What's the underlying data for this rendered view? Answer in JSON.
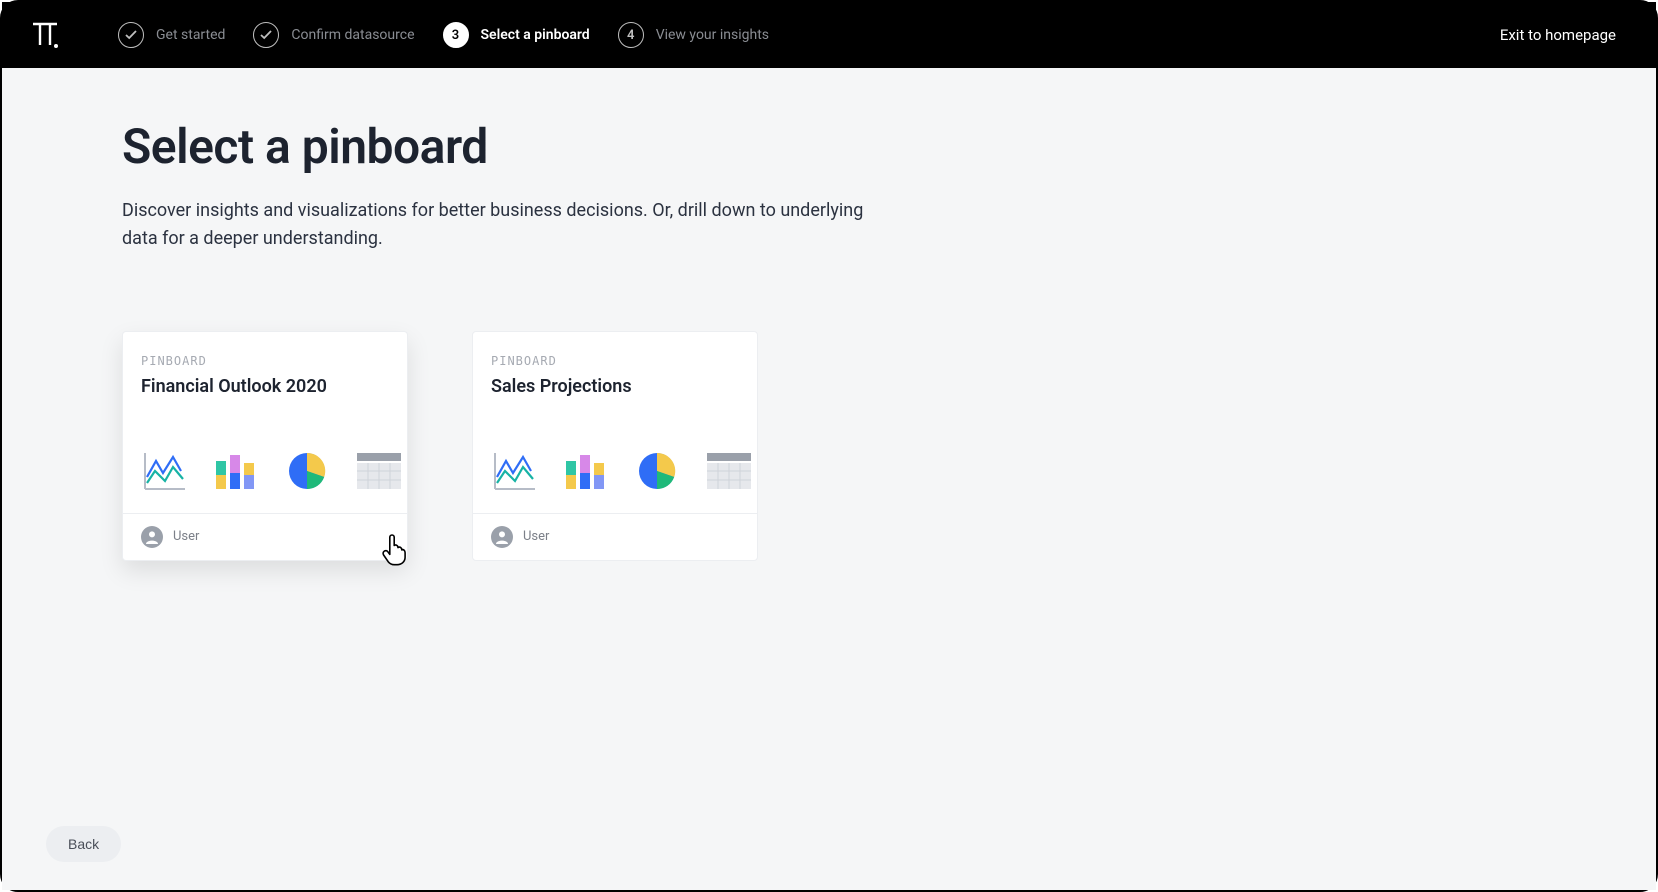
{
  "header": {
    "steps": [
      {
        "label": "Get started",
        "state": "done",
        "content": "check"
      },
      {
        "label": "Confirm datasource",
        "state": "done",
        "content": "check"
      },
      {
        "label": "Select a pinboard",
        "state": "active",
        "content": "3"
      },
      {
        "label": "View your insights",
        "state": "pending",
        "content": "4"
      }
    ],
    "exit_label": "Exit to homepage"
  },
  "main": {
    "title": "Select a pinboard",
    "description": "Discover insights and visualizations for better business decisions. Or, drill down to underlying data for a deeper understanding."
  },
  "cards": [
    {
      "eyebrow": "PINBOARD",
      "title": "Financial Outlook 2020",
      "user": "User",
      "hovered": true
    },
    {
      "eyebrow": "PINBOARD",
      "title": "Sales Projections",
      "user": "User",
      "hovered": false
    }
  ],
  "footer": {
    "back_label": "Back"
  }
}
